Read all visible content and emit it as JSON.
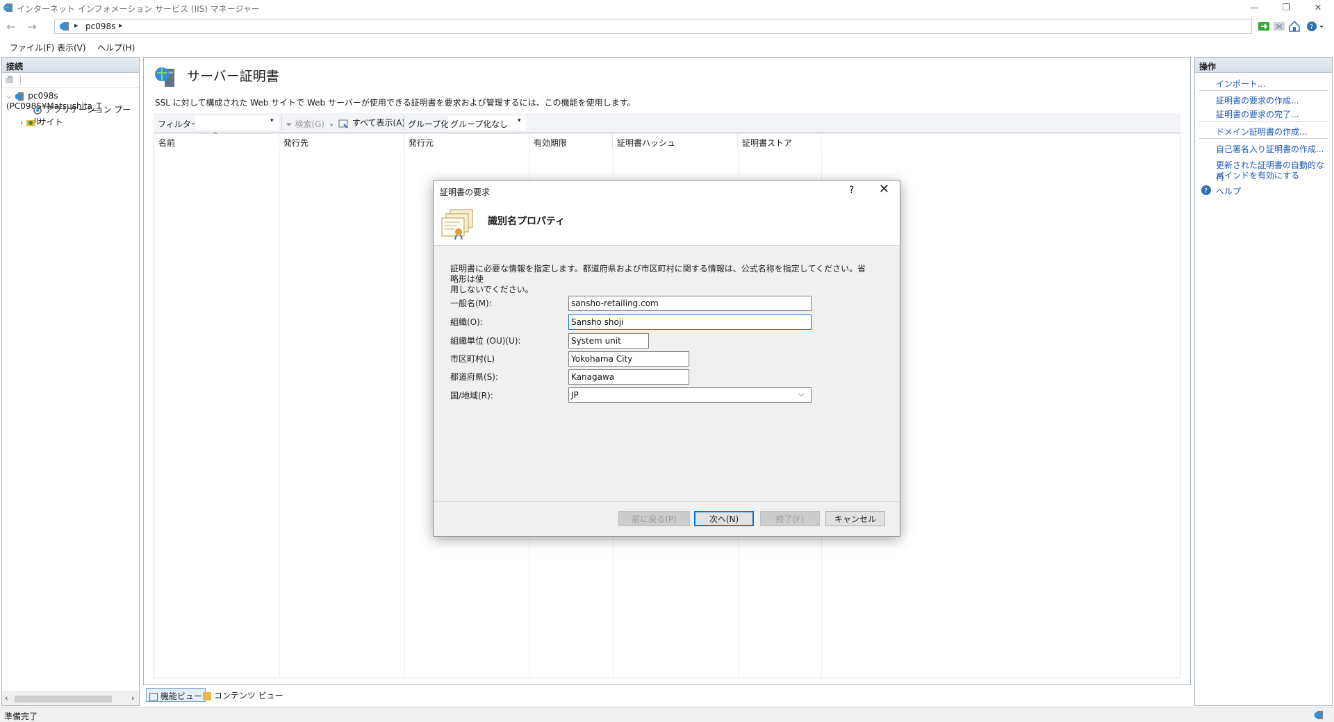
{
  "window": {
    "title": "インターネット インフォメーション サービス (IIS) マネージャー"
  },
  "address": {
    "crumb": "pc098s"
  },
  "menu": [
    "ファイル(F)",
    "表示(V)",
    "ヘルプ(H)"
  ],
  "connections": {
    "header": "接続",
    "server_node": "pc098s (PC098S¥Matsushita_T",
    "app_pool_node": "アプリケーション プール",
    "sites_node": "サイト"
  },
  "main": {
    "title": "サーバー証明書",
    "description": "SSL に対して構成された Web サイトで Web サーバーが使用できる証明書を要求および管理するには、この機能を使用します。",
    "filter_label": "フィルター:",
    "search_label": "検索(G)",
    "show_all_label": "すべて表示(A)",
    "group_label": "グループ化:",
    "group_value": "グループ化なし",
    "columns": [
      "名前",
      "発行先",
      "発行元",
      "有効期限",
      "証明書ハッシュ",
      "証明書ストア"
    ]
  },
  "viewtabs": {
    "features": "機能ビュー",
    "content": "コンテンツ ビュー"
  },
  "actions": {
    "header": "操作",
    "import": "インポート...",
    "create_request": "証明書の要求の作成...",
    "complete_request": "証明書の要求の完了...",
    "create_domain": "ドメイン証明書の作成...",
    "create_self_signed": "自己署名入り証明書の作成...",
    "auto_rebind_line1": "更新された証明書の自動的な再",
    "auto_rebind_line2": "バインドを有効にする",
    "help": "ヘルプ"
  },
  "status": {
    "text": "準備完了"
  },
  "dialog": {
    "title": "証明書の要求",
    "help": "?",
    "heading": "識別名プロパティ",
    "desc_line1": "証明書に必要な情報を指定します。都道府県および市区町村に関する情報は、公式名称を指定してください。省略形は使",
    "desc_line2": "用しないでください。",
    "labels": {
      "common_name": "一般名(M):",
      "organization": "組織(O):",
      "org_unit": "組織単位 (OU)(U):",
      "city": "市区町村(L)",
      "state": "都道府県(S):",
      "country": "国/地域(R):"
    },
    "values": {
      "common_name": "sansho-retailing.com",
      "organization": "Sansho shoji",
      "org_unit": "System unit",
      "city": "Yokohama City",
      "state": "Kanagawa",
      "country": "JP"
    },
    "buttons": {
      "back": "前に戻る(P)",
      "next": "次へ(N)",
      "finish": "終了(F)",
      "cancel": "キャンセル"
    }
  },
  "colors": {
    "accent": "#0078d7",
    "link": "#1f58b5"
  }
}
